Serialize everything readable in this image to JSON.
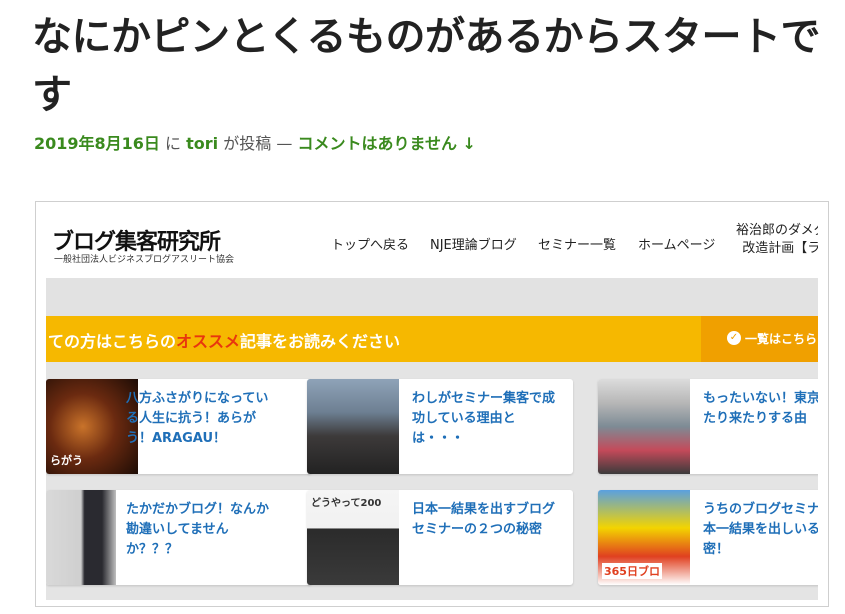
{
  "post": {
    "title": "なにかピンとくるものがあるからスタートです",
    "date": "2019年8月16日",
    "ni": "に",
    "author": "tori",
    "posted": "が投稿",
    "dash": "—",
    "comments": "コメントはありません ↓"
  },
  "embedded": {
    "logo": "ブログ集客研究所",
    "logo_sub": "一般社団法人ビジネスブログアスリート協会",
    "nav": [
      "トップへ戻る",
      "NJE理論ブログ",
      "セミナー一覧",
      "ホームページ"
    ],
    "nav_last_line1": "裕治郎のダメダ",
    "nav_last_line2": "改造計画【ラ",
    "banner_prefix": "ての方はこちらの",
    "banner_accent": "オススメ",
    "banner_suffix": "記事をお読みください",
    "banner_button": "一覧はこちら",
    "cards": [
      {
        "text": "八方ふさがりになっている人生に抗う！あらがう！ARAGAU！",
        "thumb_caption": "らがう"
      },
      {
        "text": "わしがセミナー集客で成功している理由とは・・・",
        "thumb_caption": ""
      },
      {
        "text": "もったいない！東京行ったり来たりする由",
        "thumb_caption": ""
      },
      {
        "text": "たかだかブログ！なんか勘違いしてませんか？？？",
        "thumb_caption": ""
      },
      {
        "text": "日本一結果を出すブログセミナーの２つの秘密",
        "thumb_caption": "どうやって200"
      },
      {
        "text": "うちのブログセミナが日本一結果を出しいる秘密！",
        "thumb_caption": "365日ブロ"
      }
    ]
  }
}
